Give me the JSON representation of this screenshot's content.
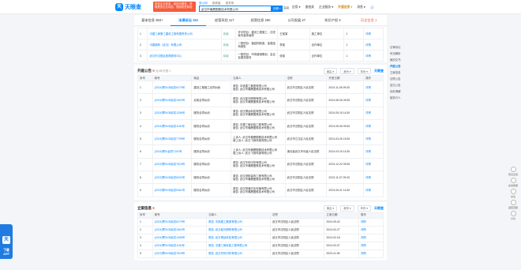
{
  "header": {
    "logo_text": "天眼查",
    "promo_text": "查找企业信息，就用天眼查，获取更多企业动态，提前防范风险",
    "mini_tabs": [
      "查公司",
      "查老板",
      "查关系"
    ],
    "search_value": "武汉市瀚晟图像技术有限公司",
    "search_button": "天眼一下",
    "adv_label": "高级",
    "nav": [
      "应用 ▾",
      "查拍卖",
      "企业服务 ▾",
      "开通会员 ▾",
      "消息 ▾"
    ]
  },
  "tabs": [
    {
      "label": "基本信息 383+"
    },
    {
      "label": "法律诉讼 151"
    },
    {
      "label": "经营风险 117"
    },
    {
      "label": "经营信息 250"
    },
    {
      "label": "公司发展 27"
    },
    {
      "label": "知识产权 3"
    },
    {
      "label": "历史信息 1"
    }
  ],
  "table_top": {
    "rows": [
      [
        "1",
        "中建三局第三建设工程有限责任公司",
        "存续",
        "许可项目：建设工程施工，住宅室内装饰装修",
        "王某某",
        "施工单位",
        "1",
        "详情"
      ],
      [
        "2",
        "中建钢构（武汉）有限公司",
        "存续",
        "一般项目：钢结构制造，金属结构销售",
        "李某",
        "合作单位",
        "1",
        "详情"
      ],
      [
        "3",
        "武汉市汉阳区政府服务中心",
        "存续",
        "一般项目：市场营销策划，会议及展览服务",
        "张某",
        "合作单位",
        "1",
        "详情"
      ]
    ]
  },
  "section1": {
    "title": "开庭公告",
    "count": "9",
    "sub": "近5年开庭 1",
    "filters": [
      "案由 ▾",
      "身份 ▾",
      "年份 ▾"
    ],
    "brand": "天眼查",
    "columns": [
      "序号",
      "案号",
      "案由",
      "当事人",
      "法院",
      "开庭日期",
      "操作"
    ],
    "rows": [
      [
        "1",
        "(2024)鄂0105民初6279号",
        "建设工程施工合同纠纷",
        "原告: 中铁建工集团有限公司\n被告: 武汉市瀚晟图像技术有限公司",
        "武汉市汉阳区人民法院",
        "2024-11-05 09:30",
        "详情"
      ],
      [
        "2",
        "(2024)鄂0105民初1562号",
        "买卖合同纠纷",
        "原告: 武汉星光照明有限公司\n被告: 武汉市瀚晟图像技术有限公司",
        "武汉市汉阳区人民法院",
        "2024-08-26 09:30",
        "详情"
      ],
      [
        "3",
        "(2024)鄂0105民初1286号",
        "服务合同纠纷",
        "原告: 武汉博远科技有限公司\n被告: 武汉市瀚晟图像技术有限公司",
        "武汉市汉阳区人民法院",
        "2024-05-15 14:30",
        "详情"
      ],
      [
        "4",
        "(2024)鄂0105民初1184号",
        "服务合同纠纷",
        "原告: 中建三局安装工程有限公司\n被告: 武汉市瀚晟图像技术有限公司",
        "武汉市汉阳区人民法院",
        "2024-05-06 09:30",
        "详情"
      ],
      [
        "5",
        "(2024)鄂0103民初7795号",
        "服务合同纠纷",
        "上诉人: 武汉市瀚晟图像技术有限公司\n被上诉人: 武汉飞扬传媒有限公司",
        "武汉市江汉区人民法院",
        "2024-03-26 15:30",
        "详情"
      ],
      [
        "6",
        "(2024)鄂01民终7102号",
        "服务合同纠纷",
        "上诉人: 武汉市瀚晟图像技术有限公司\n被上诉人: 武汉飞扬传媒有限公司",
        "湖北省武汉市中级人民法院",
        "2024-03-15 14:30",
        "详情"
      ],
      [
        "7",
        "(2023)鄂0105民初7815号",
        "服务合同纠纷",
        "原告: 武汉华彩印务有限公司\n被告: 武汉市瀚晟图像技术有限公司",
        "武汉市汉阳区人民法院",
        "2023-12-22 09:30",
        "详情"
      ],
      [
        "8",
        "(2023)鄂0105民初6932号",
        "服务合同纠纷",
        "原告: 武汉领航装饰工程有限公司\n被告: 武汉市瀚晟图像技术有限公司",
        "武汉市汉阳区人民法院",
        "2023-11-07 09:30",
        "详情"
      ],
      [
        "9",
        "(2023)鄂0105民初5361号",
        "服务合同纠纷",
        "原告: 武汉恒通文化传播有限公司\n被告: 武汉市瀚晟图像技术有限公司",
        "武汉市汉阳区人民法院",
        "2023-09-21 14:30",
        "详情"
      ]
    ]
  },
  "section2": {
    "title": "立案信息",
    "count": "6",
    "filters": [
      "案由 ▾",
      "身份 ▾",
      "年份 ▾"
    ],
    "brand": "天眼查",
    "columns": [
      "序号",
      "案号",
      "当事人",
      "法院",
      "立案日期",
      "操作"
    ],
    "rows": [
      [
        "1",
        "(2024)鄂0105民初6279号",
        "原告: 中铁建工集团有限公司",
        "武汉市汉阳区人民法院",
        "2024-09-02",
        "详情"
      ],
      [
        "2",
        "(2024)鄂0105民初1562号",
        "原告: 武汉星光照明有限公司",
        "武汉市汉阳区人民法院",
        "2024-02-27",
        "详情"
      ],
      [
        "3",
        "(2024)鄂0105民初1286号",
        "原告: 武汉博远科技有限公司",
        "武汉市汉阳区人民法院",
        "2024-02-18",
        "详情"
      ],
      [
        "4",
        "(2024)鄂0105民初1184号",
        "原告: 中建三局安装工程有限公司",
        "武汉市汉阳区人民法院",
        "2024-02-07",
        "详情"
      ],
      [
        "5",
        "(2023)鄂0105民初7815号",
        "原告: 武汉华彩印务有限公司",
        "武汉市汉阳区人民法院",
        "2023-11-08",
        "详情"
      ]
    ]
  },
  "sidebar": {
    "items": [
      "法律诉讼",
      "司法解析",
      "裁判文书",
      "开庭公告",
      "立案信息",
      "法院公告",
      "送达公告",
      "诉前调解",
      "被执行人"
    ],
    "active_index": 3
  },
  "float_right": [
    "意见反馈",
    "在线客服",
    "关注",
    "返回顶部",
    "分享"
  ],
  "app_badge": {
    "line1": "下载",
    "line2": "APP"
  },
  "colors": {
    "accent": "#0084ff",
    "warn": "#f45c3c",
    "active_status": "#3aa876"
  }
}
